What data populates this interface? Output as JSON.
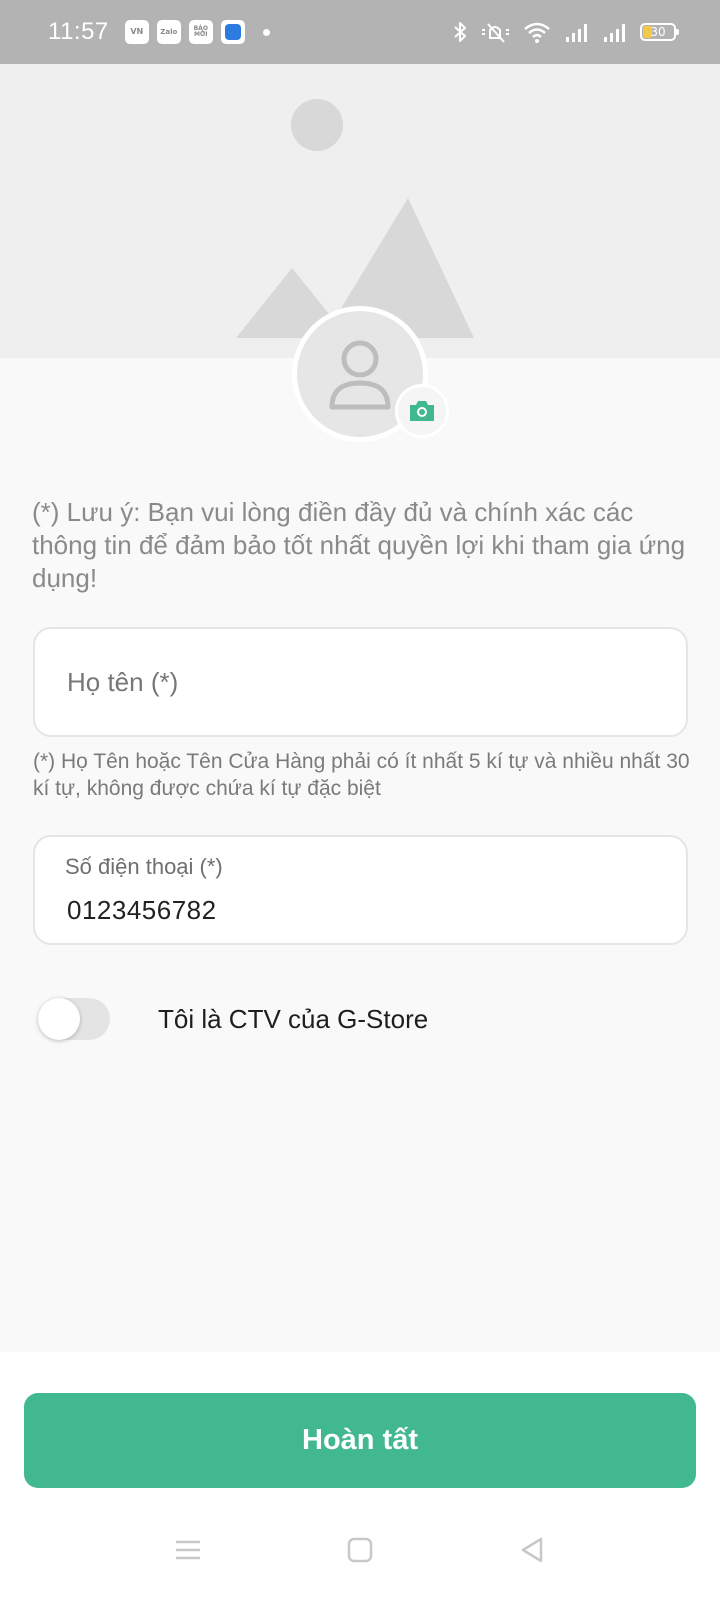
{
  "status_bar": {
    "time": "11:57",
    "notification_icons": [
      {
        "name": "vn-express-app-icon",
        "text": "VN"
      },
      {
        "name": "zalo-app-icon",
        "text": "Zalo"
      },
      {
        "name": "bao-moi-app-icon",
        "text": "BÁO MỚI"
      },
      {
        "name": "blue-app-icon",
        "text": ""
      }
    ],
    "battery": "30"
  },
  "profile": {
    "cover_icon": "image-placeholder-icon",
    "avatar_icon": "user-icon",
    "camera_icon": "camera-icon"
  },
  "form": {
    "note": "(*) Lưu ý: Bạn vui lòng điền đầy đủ và chính xác các thông tin để đảm bảo tốt nhất quyền lợi khi tham gia ứng dụng!",
    "name_placeholder": "Họ tên (*)",
    "name_hint": "(*) Họ Tên hoặc Tên Cửa Hàng phải có ít nhất 5 kí tự và nhiều nhất 30 kí tự, không được chứa kí tự đặc biệt",
    "phone_label": "Số điện thoại (*)",
    "phone_value": "0123456782",
    "ctv_toggle_label": "Tôi là CTV của G-Store",
    "ctv_toggle_on": false
  },
  "actions": {
    "done_label": "Hoàn tất"
  },
  "colors": {
    "accent": "#41b890",
    "status_bar": "#b3b3b3"
  }
}
